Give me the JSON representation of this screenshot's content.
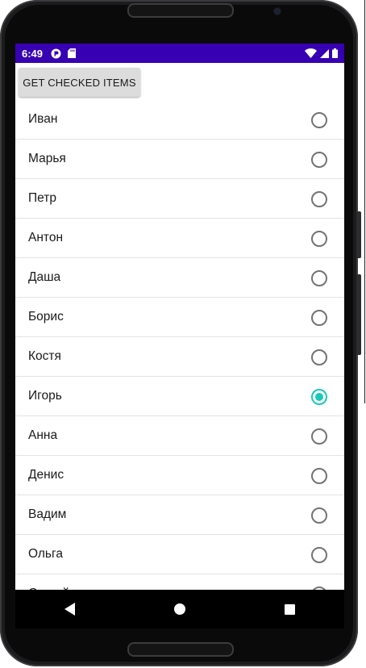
{
  "status_bar": {
    "time": "6:49",
    "left_icons": [
      "app-notification-icon",
      "sd-card-icon"
    ],
    "right_icons": [
      "wifi-icon",
      "signal-icon",
      "battery-icon"
    ],
    "color": "#3700b3"
  },
  "toolbar": {
    "get_checked_label": "GET CHECKED ITEMS"
  },
  "list": {
    "items": [
      {
        "label": "Иван",
        "checked": false
      },
      {
        "label": "Марья",
        "checked": false
      },
      {
        "label": "Петр",
        "checked": false
      },
      {
        "label": "Антон",
        "checked": false
      },
      {
        "label": "Даша",
        "checked": false
      },
      {
        "label": "Борис",
        "checked": false
      },
      {
        "label": "Костя",
        "checked": false
      },
      {
        "label": "Игорь",
        "checked": true
      },
      {
        "label": "Анна",
        "checked": false
      },
      {
        "label": "Денис",
        "checked": false
      },
      {
        "label": "Вадим",
        "checked": false
      },
      {
        "label": "Ольга",
        "checked": false
      },
      {
        "label": "Сергей",
        "checked": false
      }
    ],
    "accent_color": "#18c9b8"
  },
  "nav_bar": {
    "icons": [
      "back-icon",
      "home-icon",
      "recent-apps-icon"
    ]
  }
}
